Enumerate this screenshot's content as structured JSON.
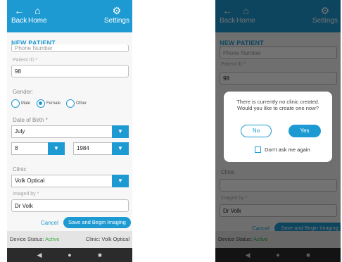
{
  "appbar": {
    "back_label": "Back",
    "home_label": "Home",
    "settings_label": "Settings",
    "back_icon": "←",
    "home_icon": "⌂",
    "settings_icon": "⚙"
  },
  "form": {
    "title": "NEW PATIENT",
    "phone_placeholder": "Phone Number",
    "patient_id_label": "Patient ID *",
    "patient_id_value": "98",
    "gender_label": "Gender:",
    "gender_options": [
      "Male",
      "Female",
      "Other"
    ],
    "gender_selected": "Female",
    "dob_label": "Date of Birth *",
    "dob_month": "July",
    "dob_day": "8",
    "dob_year": "1984",
    "clinic_label": "Clinic",
    "clinic_value": "Volk Optical",
    "imaged_by_label": "Imaged by *",
    "imaged_by_value": "Dr Volk",
    "cancel_label": "Cancel",
    "save_label": "Save and Begin Imaging",
    "dropdown_icon": "▼"
  },
  "status": {
    "device_label": "Device Status:",
    "device_value": "Active",
    "clinic_label": "Clinic:",
    "clinic_value": "Volk Optical"
  },
  "nav": {
    "back": "◀",
    "home": "●",
    "recents": "■"
  },
  "dialog": {
    "message": "There is currently no clinic created. Would you like to create one now?",
    "no_label": "No",
    "yes_label": "Yes",
    "dont_ask_label": "Don't ask me again"
  },
  "colors": {
    "accent": "#1e9ad3",
    "active": "#3cb043"
  }
}
